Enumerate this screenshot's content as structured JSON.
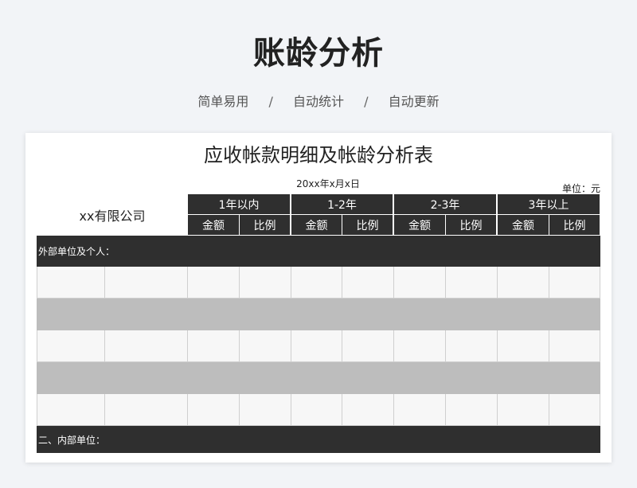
{
  "hero": {
    "title": "账龄分析",
    "tags": [
      "简单易用",
      "自动统计",
      "自动更新"
    ],
    "separator": "/"
  },
  "sheet": {
    "title": "应收帐款明细及帐龄分析表",
    "date": "20xx年x月x日",
    "unit": "单位：元",
    "company": "xx有限公司",
    "periods": [
      "1年以内",
      "1-2年",
      "2-3年",
      "3年以上"
    ],
    "sub_headers": [
      "金额",
      "比例"
    ],
    "section_external": "外部单位及个人：",
    "section_internal": "二、内部单位："
  }
}
